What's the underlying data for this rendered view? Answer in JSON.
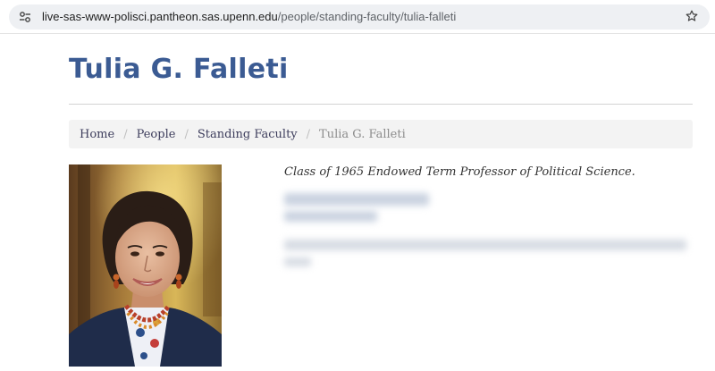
{
  "browser": {
    "url_host": "live-sas-www-polisci.pantheon.sas.upenn.edu",
    "url_path": "/people/standing-faculty/tulia-falleti",
    "site_info_icon": "tune-icon",
    "bookmark_icon": "star-outline-icon"
  },
  "page": {
    "title": "Tulia G. Falleti",
    "title_color": "#3b5b93"
  },
  "breadcrumb": {
    "home": "Home",
    "people": "People",
    "standing_faculty": "Standing Faculty",
    "current": "Tulia G. Falleti",
    "separator": "/"
  },
  "profile": {
    "role": "Class of 1965 Endowed Term Professor of Political Science.",
    "portrait_icon": "faculty-portrait"
  }
}
